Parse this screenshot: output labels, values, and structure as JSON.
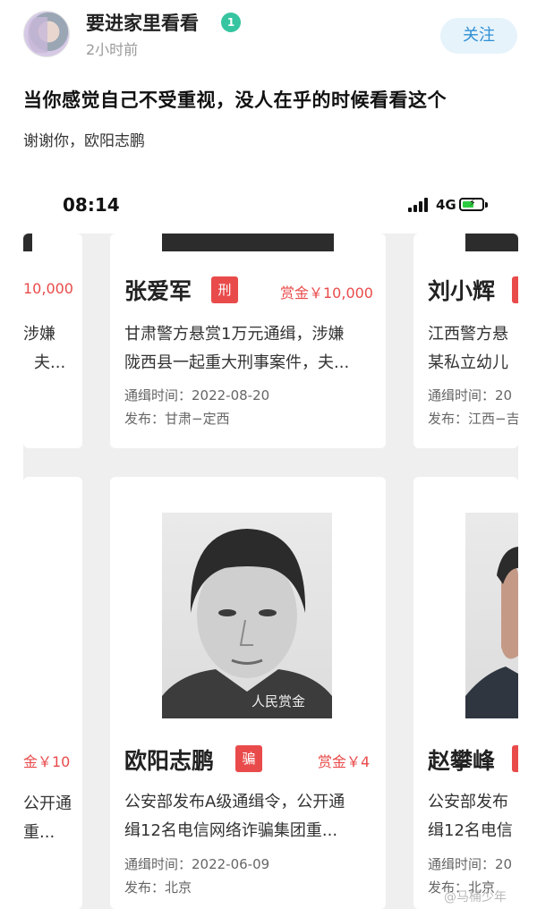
{
  "post": {
    "username": "要进家里看看",
    "badge": "1",
    "time": "2小时前",
    "follow_label": "关注",
    "title": "当你感觉自己不受重视，没人在乎的时候看看这个",
    "subtitle": "谢谢你，欧阳志鹏"
  },
  "screenshot": {
    "clock": "08:14",
    "network": "4G",
    "cards": {
      "left_top": {
        "reward": "10,000",
        "desc1": "涉嫌",
        "desc2": "夫..."
      },
      "center_top": {
        "name": "张爱军",
        "tag": "刑",
        "reward": "赏金￥10,000",
        "desc1": "甘肃警方悬赏1万元通缉，涉嫌",
        "desc2": "陇西县一起重大刑事案件，夫...",
        "time": "通缉时间：2022-08-20",
        "publisher": "发布：甘肃−定西"
      },
      "right_top": {
        "name": "刘小辉",
        "desc1": "江西警方悬",
        "desc2": "某私立幼儿",
        "time": "通缉时间：20",
        "publisher": "发布：江西−吉"
      },
      "left_bottom": {
        "reward": "金￥10",
        "desc1": "公开通",
        "desc2": "重..."
      },
      "center_bottom": {
        "name": "欧阳志鹏",
        "tag": "骗",
        "reward": "赏金￥4",
        "photo_caption": "人民赏金",
        "desc1": "公安部发布A级通缉令，公开通",
        "desc2": "缉12名电信网络诈骗集团重...",
        "time": "通缉时间：2022-06-09",
        "publisher": "发布：北京"
      },
      "right_bottom": {
        "name": "赵攀峰",
        "desc1": "公安部发布",
        "desc2": "缉12名电信",
        "time": "通缉时间：20",
        "publisher": "发布：北京"
      }
    }
  },
  "watermark": "@马桶少年",
  "colors": {
    "accent_red": "#e94b4b",
    "follow_blue": "#2f8fd5",
    "badge_green": "#36c5a0"
  }
}
